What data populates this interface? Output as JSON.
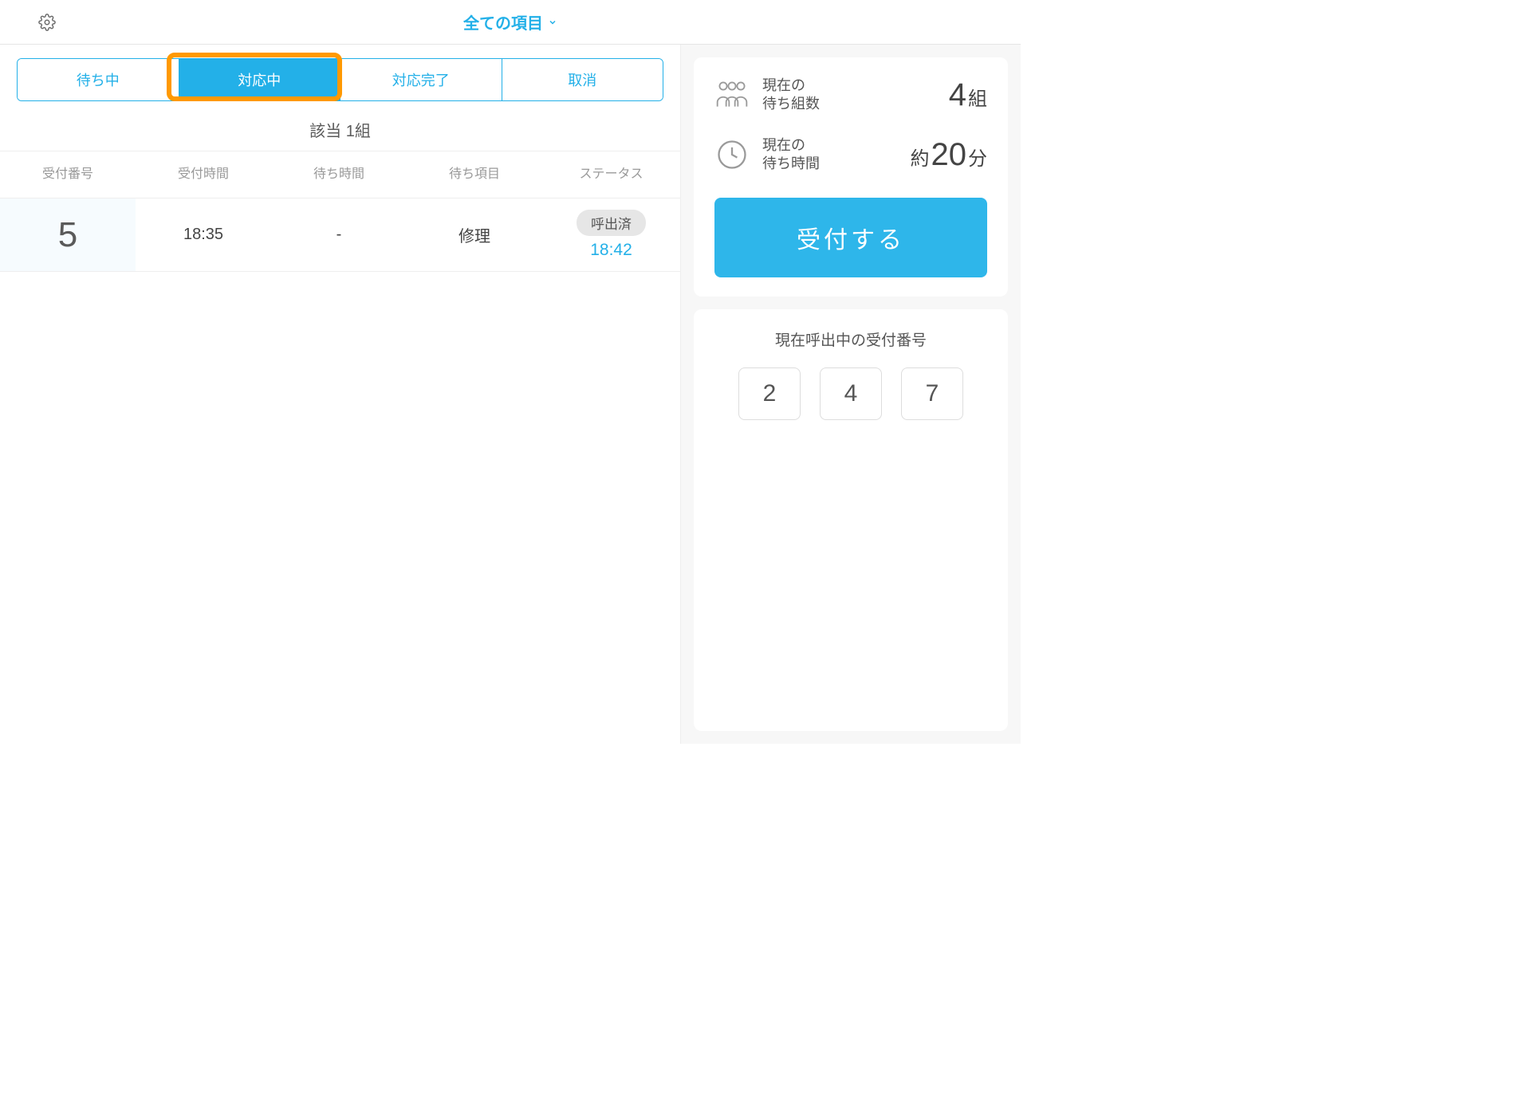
{
  "header": {
    "title": "全ての項目"
  },
  "tabs": {
    "waiting": "待ち中",
    "inprogress": "対応中",
    "done": "対応完了",
    "cancel": "取消",
    "active_index": 1
  },
  "summary_line": "該当 1組",
  "columns": {
    "number": "受付番号",
    "receive_time": "受付時間",
    "wait_time": "待ち時間",
    "item": "待ち項目",
    "status": "ステータス"
  },
  "rows": [
    {
      "number": "5",
      "receive_time": "18:35",
      "wait_time": "-",
      "item": "修理",
      "status_label": "呼出済",
      "status_time": "18:42"
    }
  ],
  "side": {
    "wait_groups_label1": "現在の",
    "wait_groups_label2": "待ち組数",
    "wait_groups_value": "4",
    "wait_groups_unit": "組",
    "wait_time_label1": "現在の",
    "wait_time_label2": "待ち時間",
    "wait_time_prefix": "約",
    "wait_time_value": "20",
    "wait_time_unit": "分",
    "accept_button": "受付する",
    "calling_title": "現在呼出中の受付番号",
    "calling_numbers": [
      "2",
      "4",
      "7"
    ]
  }
}
